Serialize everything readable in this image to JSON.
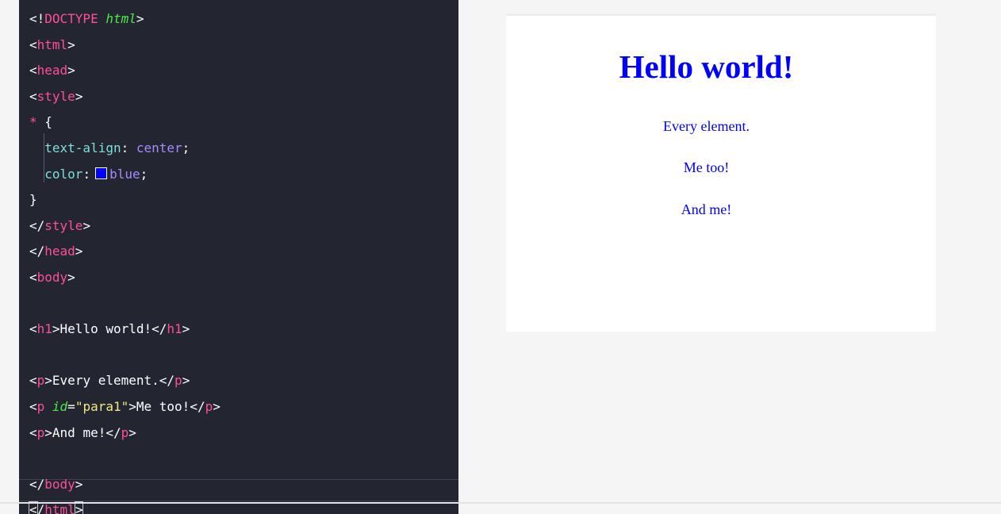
{
  "editor": {
    "lines": [
      {
        "parts": [
          {
            "t": "<!",
            "c": "txt"
          },
          {
            "t": "DOCTYPE ",
            "c": "doctype"
          },
          {
            "t": "html",
            "c": "kw"
          },
          {
            "t": ">",
            "c": "txt"
          }
        ]
      },
      {
        "parts": [
          {
            "t": "<",
            "c": "txt"
          },
          {
            "t": "html",
            "c": "tag"
          },
          {
            "t": ">",
            "c": "txt"
          }
        ]
      },
      {
        "parts": [
          {
            "t": "<",
            "c": "txt"
          },
          {
            "t": "head",
            "c": "tag"
          },
          {
            "t": ">",
            "c": "txt"
          }
        ]
      },
      {
        "parts": [
          {
            "t": "<",
            "c": "txt"
          },
          {
            "t": "style",
            "c": "tag"
          },
          {
            "t": ">",
            "c": "txt"
          }
        ]
      },
      {
        "parts": [
          {
            "t": "* ",
            "c": "star"
          },
          {
            "t": "{",
            "c": "txt"
          }
        ]
      },
      {
        "parts": [
          {
            "t": "  ",
            "c": "txt"
          },
          {
            "t": "text-align",
            "c": "prop"
          },
          {
            "t": ": ",
            "c": "txt"
          },
          {
            "t": "center",
            "c": "val"
          },
          {
            "t": ";",
            "c": "txt"
          }
        ]
      },
      {
        "parts": [
          {
            "t": "  ",
            "c": "txt"
          },
          {
            "t": "color",
            "c": "prop"
          },
          {
            "t": ":",
            "c": "txt"
          },
          {
            "t": "",
            "c": "swatch"
          },
          {
            "t": "blue",
            "c": "val"
          },
          {
            "t": ";",
            "c": "txt"
          }
        ]
      },
      {
        "parts": [
          {
            "t": "}",
            "c": "txt"
          }
        ]
      },
      {
        "parts": [
          {
            "t": "</",
            "c": "txt"
          },
          {
            "t": "style",
            "c": "tag"
          },
          {
            "t": ">",
            "c": "txt"
          }
        ]
      },
      {
        "parts": [
          {
            "t": "</",
            "c": "txt"
          },
          {
            "t": "head",
            "c": "tag"
          },
          {
            "t": ">",
            "c": "txt"
          }
        ]
      },
      {
        "parts": [
          {
            "t": "<",
            "c": "txt"
          },
          {
            "t": "body",
            "c": "tag"
          },
          {
            "t": ">",
            "c": "txt"
          }
        ]
      },
      {
        "parts": []
      },
      {
        "parts": [
          {
            "t": "<",
            "c": "txt"
          },
          {
            "t": "h1",
            "c": "tag"
          },
          {
            "t": ">Hello world!</",
            "c": "txt"
          },
          {
            "t": "h1",
            "c": "tag"
          },
          {
            "t": ">",
            "c": "txt"
          }
        ]
      },
      {
        "parts": []
      },
      {
        "parts": [
          {
            "t": "<",
            "c": "txt"
          },
          {
            "t": "p",
            "c": "tag"
          },
          {
            "t": ">Every element.</",
            "c": "txt"
          },
          {
            "t": "p",
            "c": "tag"
          },
          {
            "t": ">",
            "c": "txt"
          }
        ]
      },
      {
        "parts": [
          {
            "t": "<",
            "c": "txt"
          },
          {
            "t": "p ",
            "c": "tag"
          },
          {
            "t": "id",
            "c": "kw"
          },
          {
            "t": "=",
            "c": "txt"
          },
          {
            "t": "\"para1\"",
            "c": "str"
          },
          {
            "t": ">Me too!</",
            "c": "txt"
          },
          {
            "t": "p",
            "c": "tag"
          },
          {
            "t": ">",
            "c": "txt"
          }
        ]
      },
      {
        "parts": [
          {
            "t": "<",
            "c": "txt"
          },
          {
            "t": "p",
            "c": "tag"
          },
          {
            "t": ">And me!</",
            "c": "txt"
          },
          {
            "t": "p",
            "c": "tag"
          },
          {
            "t": ">",
            "c": "txt"
          }
        ]
      },
      {
        "parts": []
      },
      {
        "parts": [
          {
            "t": "</",
            "c": "txt"
          },
          {
            "t": "body",
            "c": "tag"
          },
          {
            "t": ">",
            "c": "txt"
          }
        ]
      },
      {
        "parts": [
          {
            "t": "<",
            "c": "txt bracket-hl"
          },
          {
            "t": "/",
            "c": "txt"
          },
          {
            "t": "html",
            "c": "tag"
          },
          {
            "t": ">",
            "c": "txt bracket-hl"
          }
        ]
      }
    ],
    "colors": {
      "background": "#232530",
      "tag": "#ff4f9b",
      "keyword": "#4ee84a",
      "property": "#7ee0dc",
      "value": "#a68bff",
      "string": "#f1ea80"
    }
  },
  "preview": {
    "heading": "Hello world!",
    "paragraphs": [
      "Every element.",
      "Me too!",
      "And me!"
    ],
    "text_color": "#0000ff"
  }
}
